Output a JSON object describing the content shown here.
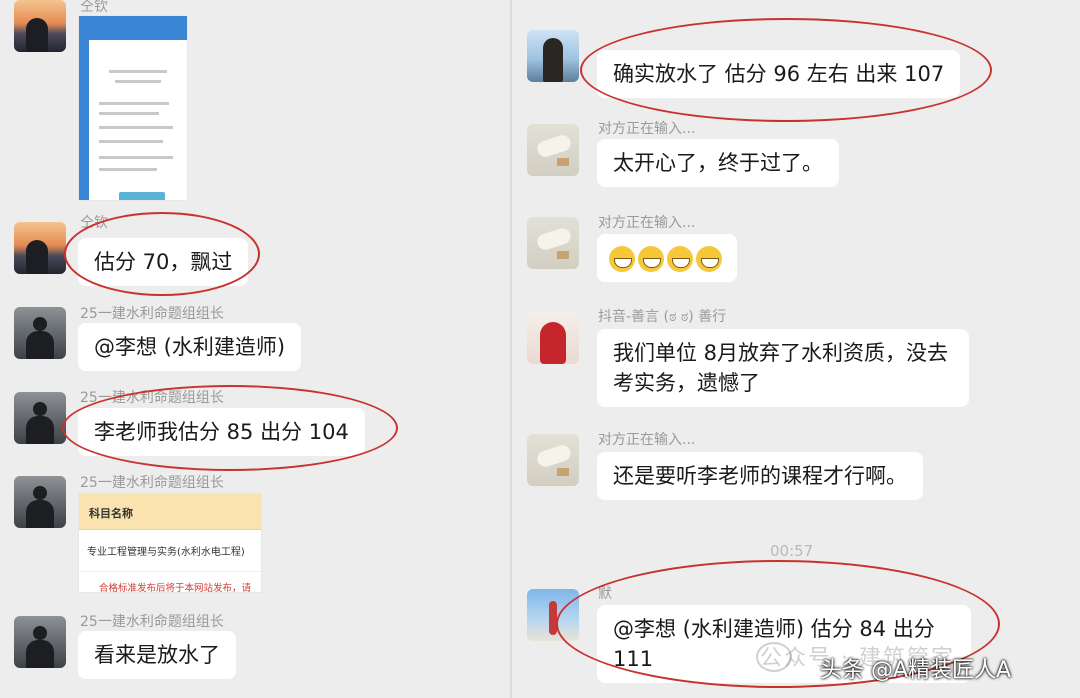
{
  "left": {
    "messages": [
      {
        "sender": "仝钦",
        "image": "screenshot"
      },
      {
        "sender": "仝钦",
        "text": "估分 70，飘过"
      },
      {
        "sender": "25一建水利命题组组长",
        "text": "@李想 (水利建造师)"
      },
      {
        "sender": "25一建水利命题组组长",
        "text": "李老师我估分 85 出分 104"
      },
      {
        "sender": "25一建水利命题组组长",
        "card": {
          "header": "科目名称",
          "row": "专业工程管理与实务(水利水电工程)",
          "warn": "合格标准发布后将于本网站发布，请"
        }
      },
      {
        "sender": "25一建水利命题组组长",
        "text": "看来是放水了"
      }
    ]
  },
  "right": {
    "messages": [
      {
        "sender": "",
        "text": "确实放水了 估分 96 左右 出来 107"
      },
      {
        "sender": "对方正在输入...",
        "text": "太开心了，终于过了。"
      },
      {
        "sender": "对方正在输入...",
        "emoji": [
          "grin",
          "grin",
          "grin",
          "grin"
        ]
      },
      {
        "sender": "抖音-善言 (ಠ ಠ) 善行",
        "text": "我们单位 8月放弃了水利资质，没去考实务，遗憾了"
      },
      {
        "sender": "对方正在输入...",
        "text": "还是要听李老师的课程才行啊。"
      },
      {
        "sender": "默",
        "text": "@李想 (水利建造师) 估分 84 出分 111"
      }
    ],
    "timestamp": "00:57"
  },
  "watermark": "公众号 · 建筑管家",
  "brand": "头条 @A精装匠人A",
  "colors": {
    "background": "#ededed",
    "bubble": "#ffffff",
    "circle": "#c8322e"
  }
}
